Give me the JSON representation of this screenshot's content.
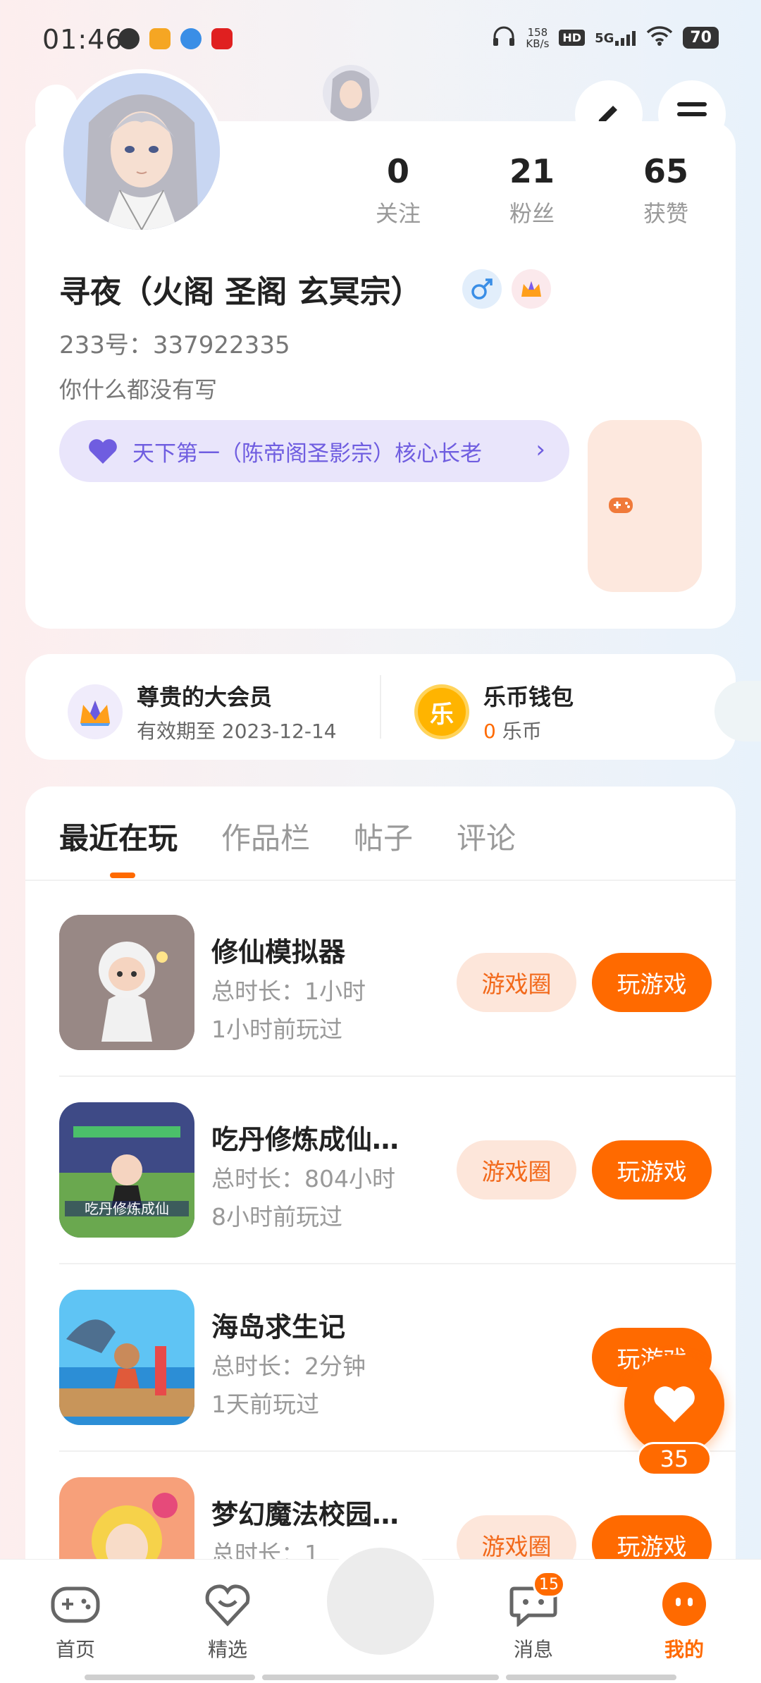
{
  "status_bar": {
    "time": "01:46",
    "net_speed_value": "158",
    "net_speed_unit": "KB/s",
    "hd": "HD",
    "signal": "5G",
    "battery": "70"
  },
  "profile": {
    "stats": [
      {
        "value": "0",
        "label": "关注"
      },
      {
        "value": "21",
        "label": "粉丝"
      },
      {
        "value": "65",
        "label": "获赞"
      }
    ],
    "nickname": "寻夜（火阁 圣阁 玄冥宗）",
    "uid": "233号：337922335",
    "bio": "你什么都没有写",
    "guild": "天下第一（陈帝阁圣影宗）核心长老"
  },
  "vip": {
    "member_title": "尊贵的大会员",
    "member_sub": "有效期至 2023-12-14",
    "wallet_title": "乐币钱包",
    "wallet_amount": "0",
    "wallet_unit": " 乐币",
    "wallet_icon_char": "乐"
  },
  "tabs": [
    "最近在玩",
    "作品栏",
    "帖子",
    "评论"
  ],
  "games": [
    {
      "name": "修仙模拟器",
      "time": "总时长：1小时",
      "last": "1小时前玩过",
      "circle_btn": "游戏圈",
      "play_btn": "玩游戏"
    },
    {
      "name": "吃丹修炼成仙…",
      "time": "总时长：804小时",
      "last": "8小时前玩过",
      "circle_btn": "游戏圈",
      "play_btn": "玩游戏"
    },
    {
      "name": "海岛求生记",
      "time": "总时长：2分钟",
      "last": "1天前玩过",
      "circle_btn": "",
      "play_btn": "玩游戏"
    },
    {
      "name": "梦幻魔法校园…",
      "time": "总时长：1",
      "last": "",
      "circle_btn": "游戏圈",
      "play_btn": "玩游戏"
    }
  ],
  "float_heart": {
    "count": "35"
  },
  "bottom_nav": [
    {
      "label": "首页",
      "icon": "gamepad-icon",
      "badge": ""
    },
    {
      "label": "精选",
      "icon": "heart-shield-icon",
      "badge": ""
    },
    {
      "label": "消息",
      "icon": "chat-icon",
      "badge": "15"
    },
    {
      "label": "我的",
      "icon": "profile-face-icon",
      "badge": ""
    }
  ],
  "colors": {
    "accent": "#ff6a00",
    "guild_purple": "#6f5de0",
    "muted": "#999999"
  }
}
